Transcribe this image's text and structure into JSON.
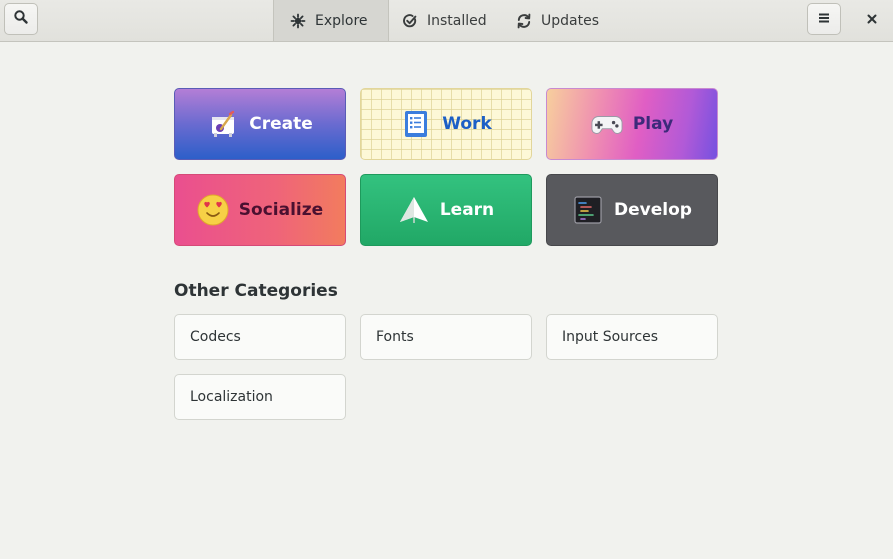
{
  "header": {
    "tabs": [
      {
        "label": "Explore",
        "icon": "explore-icon",
        "active": true
      },
      {
        "label": "Installed",
        "icon": "installed-check-icon",
        "active": false
      },
      {
        "label": "Updates",
        "icon": "updates-refresh-icon",
        "active": false
      }
    ],
    "search_icon": "search-icon",
    "menu_icon": "hamburger-menu-icon",
    "close_icon": "close-icon"
  },
  "categories": [
    {
      "label": "Create",
      "icon": "create-paint-icon"
    },
    {
      "label": "Work",
      "icon": "work-checklist-icon"
    },
    {
      "label": "Play",
      "icon": "gamepad-icon"
    },
    {
      "label": "Socialize",
      "icon": "heart-eyes-emoji-icon"
    },
    {
      "label": "Learn",
      "icon": "paper-plane-icon"
    },
    {
      "label": "Develop",
      "icon": "terminal-code-icon"
    }
  ],
  "other_categories": {
    "title": "Other Categories",
    "items": [
      "Codecs",
      "Fonts",
      "Input Sources",
      "Localization"
    ]
  },
  "colors": {
    "background": "#f1f2ee",
    "header": "#e1e1dc",
    "work_text": "#1c5fc6",
    "learn_green": "#26b06f",
    "develop_gray": "#58595d"
  }
}
